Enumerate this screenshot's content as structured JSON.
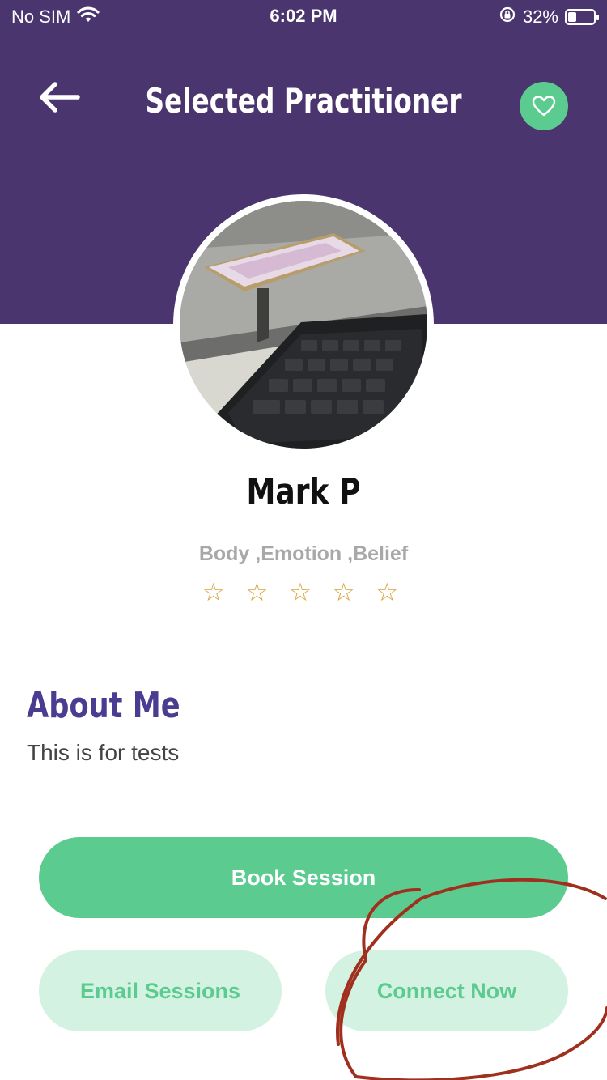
{
  "status_bar": {
    "carrier": "No SIM",
    "time": "6:02 PM",
    "battery_percent_label": "32%",
    "battery_level": 0.32,
    "icons": [
      "wifi-icon",
      "rotation-lock-icon",
      "battery-icon"
    ]
  },
  "header": {
    "title": "Selected Practitioner",
    "back_icon": "arrow-left-icon",
    "favorite_icon": "heart-icon"
  },
  "profile": {
    "name": "Mark P",
    "specialties": "Body ,Emotion ,Belief",
    "rating_stars": "☆ ☆ ☆ ☆ ☆",
    "rating_value": 0,
    "rating_max": 5
  },
  "about": {
    "title": "About Me",
    "text": "This is for tests"
  },
  "actions": {
    "book_label": "Book Session",
    "email_label": "Email Sessions",
    "connect_label": "Connect Now"
  },
  "colors": {
    "header_purple": "#4a356e",
    "accent_green": "#5ccb90",
    "light_green": "#d3f2e1",
    "about_title": "#4a3d91",
    "star_orange": "#d9a23a",
    "annotation_red": "#a0301e"
  }
}
